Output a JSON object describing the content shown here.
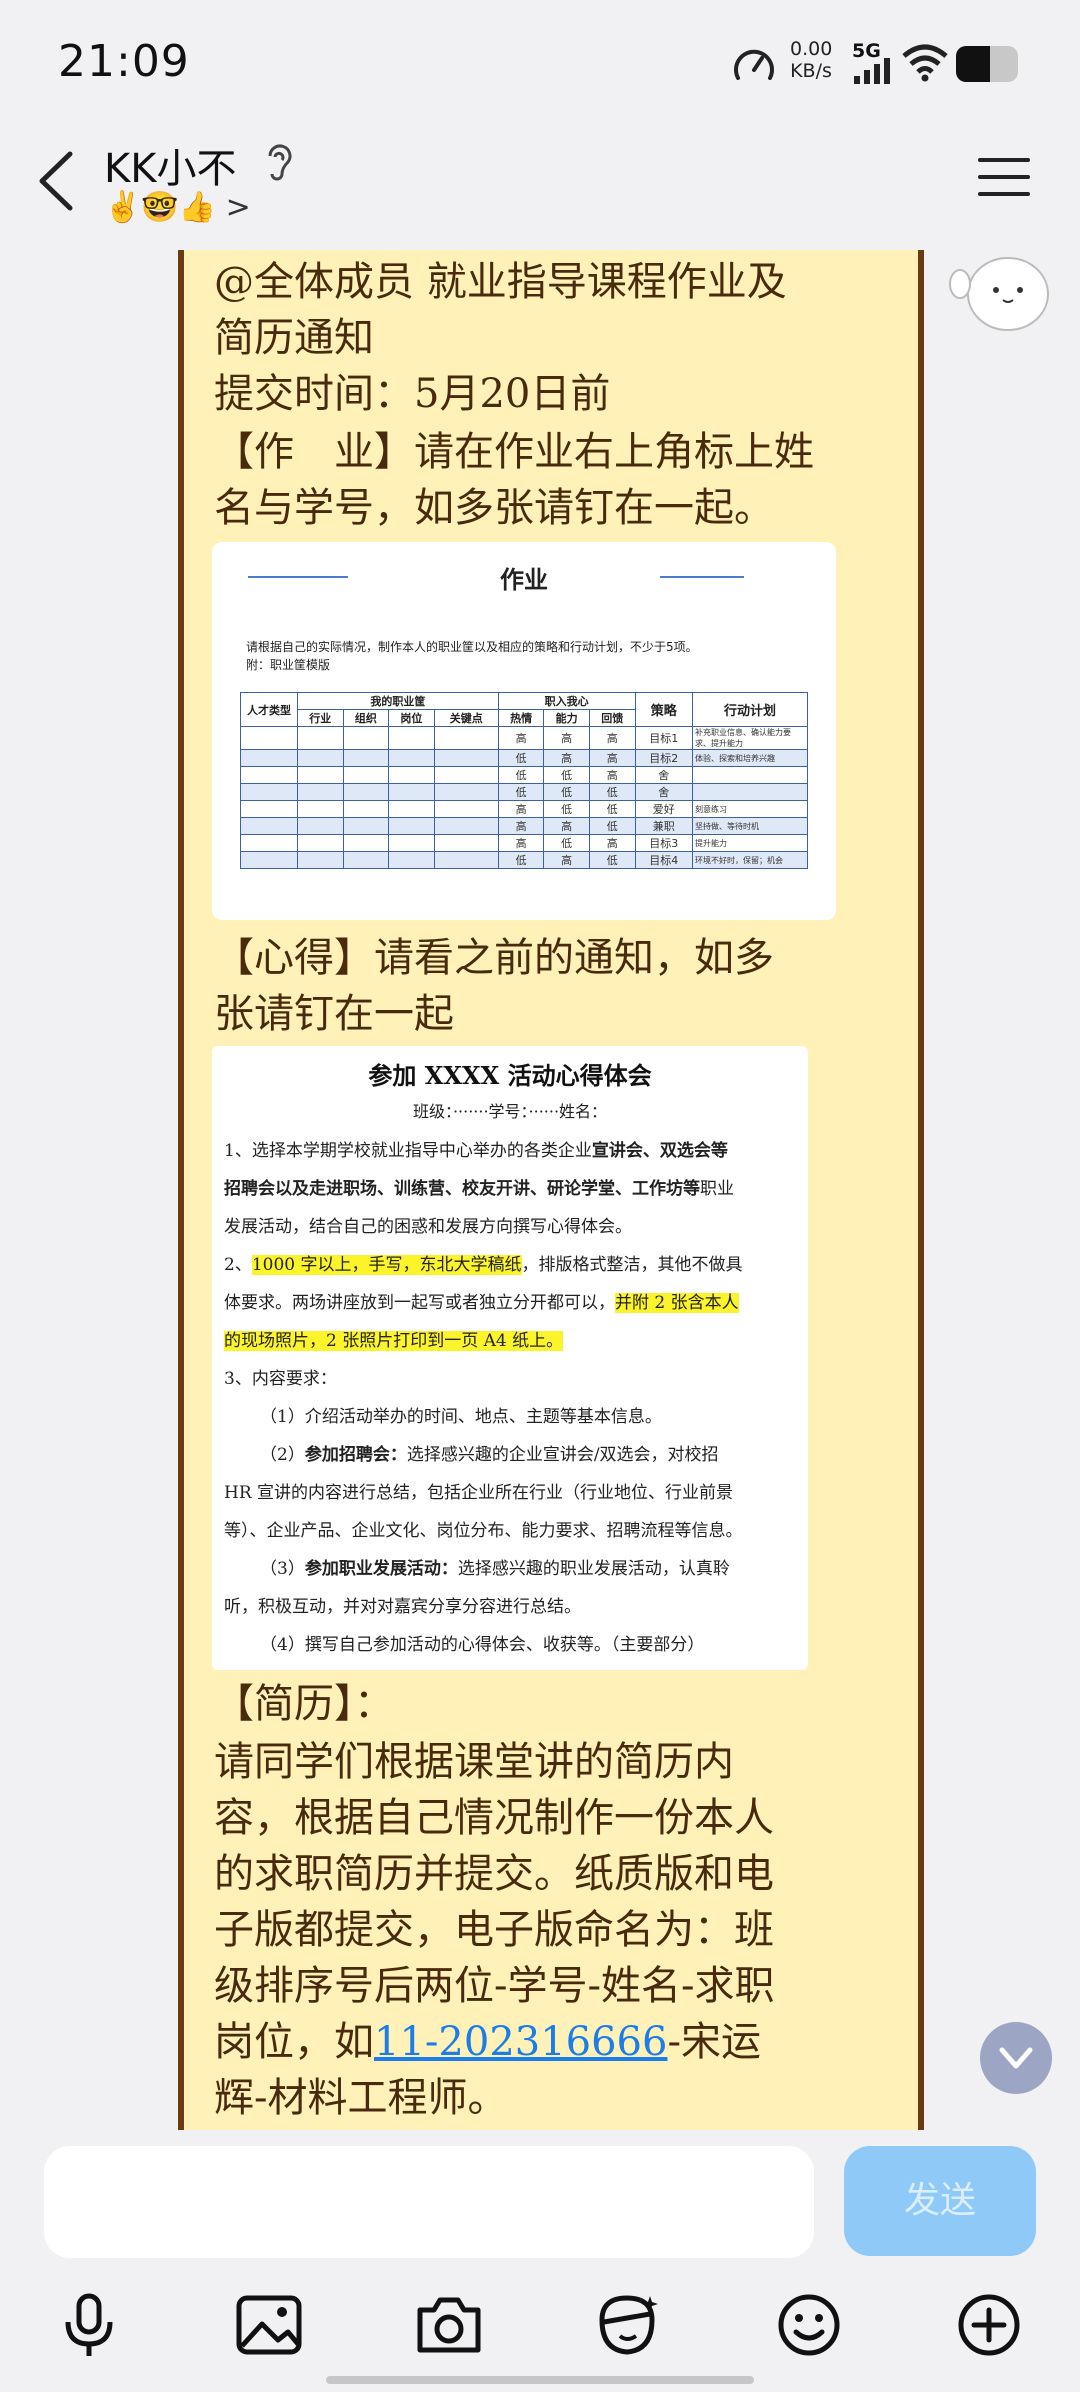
{
  "status_bar": {
    "time": "21:09",
    "net_speed_value": "0.00",
    "net_speed_unit": "KB/s",
    "network_type": "5G",
    "battery_level": 0.55
  },
  "header": {
    "contact_name": "KK小不",
    "ear_icon": "ear-icon",
    "status_emojis": "✌️🤓👍 >"
  },
  "message": {
    "line1": "@全体成员 就业指导课程作业及",
    "line2": "简历通知",
    "line3": "提交时间：5月20日前",
    "line4": "【作　业】请在作业右上角标上姓",
    "line5": "名与学号，如多张请钉在一起。",
    "line6": "【心得】请看之前的通知，如多",
    "line7": "张请钉在一起",
    "line8": "【简历】：",
    "line9": "请同学们根据课堂讲的简历内",
    "line10": "容，根据自己情况制作一份本人",
    "line11": "的求职简历并提交。纸质版和电",
    "line12": "子版都提交，电子版命名为：班",
    "line13": "级排序号后两位-学号-姓名-求职",
    "line14_a": "岗位，如",
    "line14_link": "11-202316666",
    "line14_b": "-宋运",
    "line15": "辉-材料工程师。"
  },
  "homework_sheet": {
    "title": "作业",
    "instruction": "请根据自己的实际情况，制作本人的职业筐以及相应的策略和行动计划，不少于5项。",
    "attachment": "附：职业筐模版",
    "group_headers": [
      "人才类型",
      "我的职业筐",
      "职入我心",
      "策略",
      "行动计划"
    ],
    "sub_headers": [
      "行业",
      "组织",
      "岗位",
      "关键点",
      "热情",
      "能力",
      "回馈"
    ],
    "rows": [
      [
        "高",
        "高",
        "高",
        "目标1",
        "补充职业信息、确认能力要求、提升能力"
      ],
      [
        "低",
        "高",
        "高",
        "目标2",
        "体验、探索和培养兴趣"
      ],
      [
        "低",
        "低",
        "高",
        "舍",
        ""
      ],
      [
        "低",
        "低",
        "低",
        "舍",
        ""
      ],
      [
        "高",
        "低",
        "低",
        "爱好",
        "刻意练习"
      ],
      [
        "高",
        "高",
        "低",
        "兼职",
        "坚持做、等待时机"
      ],
      [
        "高",
        "低",
        "高",
        "目标3",
        "提升能力"
      ],
      [
        "低",
        "高",
        "低",
        "目标4",
        "环境不好时，保留；机会"
      ]
    ]
  },
  "experience_doc": {
    "title": "参加 XXXX 活动心得体会",
    "meta": "班级：·······学号：······姓名：",
    "p1_a": "1、选择本学期学校就业指导中心举办的各类企业",
    "p1_b": "宣讲会、双选会等",
    "p1_c": "招聘会以及走进职场、训练营、校友开讲、研论学堂、工作坊等",
    "p1_d": "职业",
    "p1_e": "发展活动，结合自己的困惑和发展方向撰写心得体会。",
    "p2_a": "2、",
    "p2_hl": "1000 字以上，手写，东北大学稿纸",
    "p2_b": "，排版格式整洁，其他不做具",
    "p2_c": "体要求。两场讲座放到一起写或者独立分开都可以，",
    "p2_hl2": "并附 2 张含本人",
    "p2_hl3": "的现场照片，2 张照片打印到一页 A4 纸上。",
    "p3": "3、内容要求：",
    "p4": "（1）介绍活动举办的时间、地点、主题等基本信息。",
    "p5_a": "（2）",
    "p5_b": "参加招聘会：",
    "p5_c": "选择感兴趣的企业宣讲会/双选会，对校招",
    "p5_d": "HR 宣讲的内容进行总结，包括企业所在行业（行业地位、行业前景",
    "p5_e": "等）、企业产品、企业文化、岗位分布、能力要求、招聘流程等信息。",
    "p6_a": "（3）",
    "p6_b": "参加职业发展活动：",
    "p6_c": "选择感兴趣的职业发展活动，认真聆",
    "p6_d": "听，积极互动，并对对嘉宾分享分容进行总结。",
    "p7": "（4）撰写自己参加活动的心得体会、收获等。（主要部分）"
  },
  "input_bar": {
    "placeholder": "",
    "send_label": "发送"
  },
  "colors": {
    "bubble_bg": "#fff1b8",
    "bubble_border": "#6b3a12",
    "message_text": "#4a2a0e",
    "send_bg": "#8fc9f8",
    "link": "#1a7de8"
  }
}
